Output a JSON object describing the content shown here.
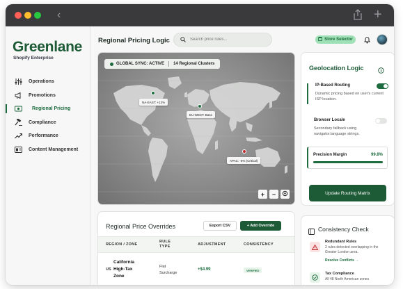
{
  "window": {
    "controls": [
      "close",
      "minimize",
      "zoom"
    ],
    "back_icon": "chevron-left-icon",
    "share_icon": "share-icon",
    "new_tab_icon": "plus-icon"
  },
  "sidebar": {
    "logo": "Greenlane",
    "logo_subtitle": "Shopify Enterprise",
    "items": [
      {
        "label": "Operations",
        "icon": "sliders-icon",
        "active": false
      },
      {
        "label": "Promotions",
        "icon": "megaphone-icon",
        "active": false
      },
      {
        "label": "Regional Pricing",
        "icon": "currency-icon",
        "active": true
      },
      {
        "label": "Compliance",
        "icon": "gavel-icon",
        "active": false
      },
      {
        "label": "Performance",
        "icon": "trend-icon",
        "active": false
      },
      {
        "label": "Content Management",
        "icon": "folder-icon",
        "active": false
      }
    ]
  },
  "header": {
    "title": "Regional Pricing Logic",
    "search_placeholder": "Search price rules...",
    "store_selector": "Store Selector",
    "bell_icon": "bell-icon",
    "avatar": "avatar"
  },
  "map": {
    "sync_status": "GLOBAL SYNC: ACTIVE",
    "clusters": "14 Regional Clusters",
    "labels": {
      "na": "NA-EAST: +12%",
      "eu": "EU-WEST: Base",
      "apac": "APAC: -5% (Critical)"
    },
    "controls": {
      "zoom_in": "+",
      "zoom_out": "−"
    }
  },
  "geolocation": {
    "title": "Geolocation Logic",
    "ip": {
      "title": "IP-Based Routing",
      "desc": "Dynamic pricing based on user's current ISP location.",
      "enabled": true
    },
    "locale": {
      "title": "Browser Locale",
      "desc": "Secondary fallback using navigator.language strings.",
      "enabled": false
    },
    "margin": {
      "label": "Precision Margin",
      "value": "99.8%",
      "fraction": 0.998
    },
    "update_button": "Update Routing Matrix"
  },
  "overrides": {
    "title": "Regional Price Overrides",
    "export_button": "Export CSV",
    "add_button": "+ Add Override",
    "columns": {
      "region": "REGION / ZONE",
      "rule_type_1": "RULE",
      "rule_type_2": "TYPE",
      "adjustment": "ADJUSTMENT",
      "consistency": "CONSISTENCY"
    },
    "rows": [
      {
        "code": "US",
        "region_1": "California",
        "region_2": "High-Tax",
        "region_3": "Zone",
        "rule_1": "Flat",
        "rule_2": "Surcharge",
        "adjustment": "+$4.99",
        "status": "VERIFIED"
      }
    ]
  },
  "consistency": {
    "title": "Consistency Check",
    "items": [
      {
        "title": "Redundant Rules",
        "desc": "2 rules detected overlapping in the Greater London area.",
        "link": "Resolve Conflicts →",
        "status": "warning"
      },
      {
        "title": "Tax Compliance",
        "desc": "All 48 North American zones",
        "status": "ok"
      }
    ]
  },
  "colors": {
    "brand": "#1d5a36",
    "accent": "#1d6b3e",
    "danger": "#c0282d",
    "pill": "#9fe0b6"
  }
}
